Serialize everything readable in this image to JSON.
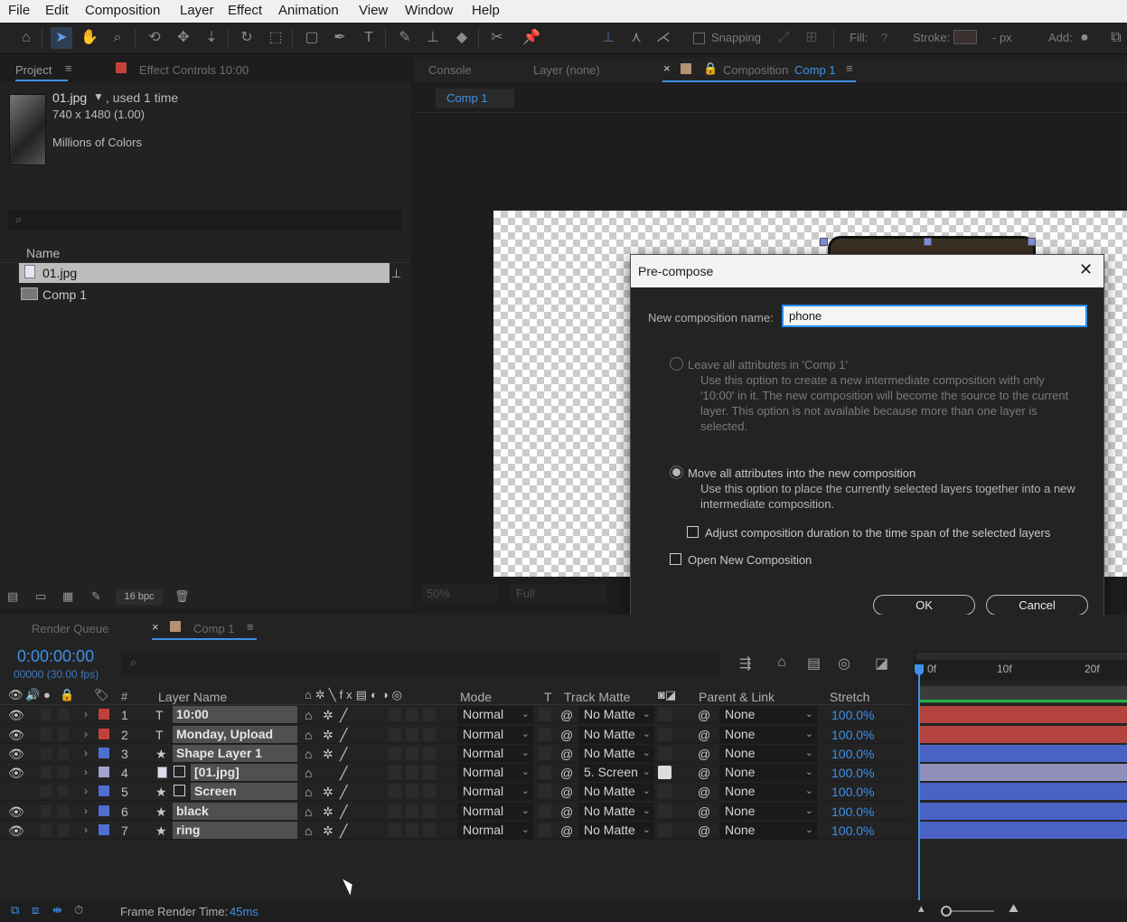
{
  "menu": [
    "File",
    "Edit",
    "Composition",
    "Layer",
    "Effect",
    "Animation",
    "View",
    "Window",
    "Help"
  ],
  "toolbar": {
    "snapping": "Snapping",
    "fill": "Fill:",
    "fill_value": "?",
    "stroke": "Stroke:",
    "stroke_unit": "- px",
    "add": "Add:"
  },
  "project": {
    "tab_project": "Project",
    "tab_effects": "Effect Controls 10:00",
    "file_name": "01.jpg",
    "used": ", used 1 time",
    "dims": "740 x 1480 (1.00)",
    "colors": "Millions of Colors",
    "col_name": "Name",
    "items": [
      {
        "name": "01.jpg",
        "selected": true
      },
      {
        "name": "Comp 1",
        "selected": false
      }
    ],
    "bpc": "16 bpc"
  },
  "viewer": {
    "tab_console": "Console",
    "tab_layer": "Layer (none)",
    "tab_comp_prefix": "Composition",
    "tab_comp": "Comp 1",
    "subtab": "Comp 1",
    "zoom": "50%",
    "quality": "Full"
  },
  "dialog": {
    "title": "Pre-compose",
    "name_label": "New composition name:",
    "name_value": "phone",
    "opt1_label": "Leave all attributes in 'Comp 1'",
    "opt1_desc": [
      "Use this option to create a new intermediate composition with only",
      "'10:00' in it. The new composition will become the source to the current",
      "layer. This option is not available because more than one layer is",
      "selected."
    ],
    "opt2_label": "Move all attributes into the new composition",
    "opt2_desc": [
      "Use this option to place the currently selected layers together into a new",
      "intermediate composition."
    ],
    "adjust_label": "Adjust composition duration to the time span of the selected layers",
    "open_label": "Open New Composition",
    "ok": "OK",
    "cancel": "Cancel"
  },
  "timeline": {
    "tab_render": "Render Queue",
    "tab_comp": "Comp 1",
    "timecode": "0:00:00:00",
    "frames": "00000 (30.00 fps)",
    "ruler": [
      "0f",
      "10f",
      "20f"
    ],
    "headers": {
      "num": "#",
      "layer_name": "Layer Name",
      "mode": "Mode",
      "t": "T",
      "track_matte": "Track Matte",
      "parent": "Parent & Link",
      "stretch": "Stretch"
    },
    "layers": [
      {
        "num": "1",
        "type": "T",
        "name": "10:00",
        "mode": "Normal",
        "matte": "No Matte",
        "parent": "None",
        "stretch": "100.0%",
        "color": "#c4403b",
        "visible": true
      },
      {
        "num": "2",
        "type": "T",
        "name": "Monday, Upload",
        "mode": "Normal",
        "matte": "No Matte",
        "parent": "None",
        "stretch": "100.0%",
        "color": "#c4403b",
        "visible": true
      },
      {
        "num": "3",
        "type": "★",
        "name": "Shape Layer 1",
        "mode": "Normal",
        "matte": "No Matte",
        "parent": "None",
        "stretch": "100.0%",
        "color": "#4e6fd1",
        "visible": true
      },
      {
        "num": "4",
        "type": "img",
        "name": "[01.jpg]",
        "mode": "Normal",
        "matte": "5. Screen",
        "parent": "None",
        "stretch": "100.0%",
        "color": "#a3a3cf",
        "visible": true
      },
      {
        "num": "5",
        "type": "★",
        "name": "Screen",
        "mode": "Normal",
        "matte": "No Matte",
        "parent": "None",
        "stretch": "100.0%",
        "color": "#4e6fd1",
        "visible": false
      },
      {
        "num": "6",
        "type": "★",
        "name": "black",
        "mode": "Normal",
        "matte": "No Matte",
        "parent": "None",
        "stretch": "100.0%",
        "color": "#4e6fd1",
        "visible": true
      },
      {
        "num": "7",
        "type": "★",
        "name": "ring",
        "mode": "Normal",
        "matte": "No Matte",
        "parent": "None",
        "stretch": "100.0%",
        "color": "#4e6fd1",
        "visible": true
      }
    ],
    "render_label": "Frame Render Time:",
    "render_value": "45ms"
  }
}
